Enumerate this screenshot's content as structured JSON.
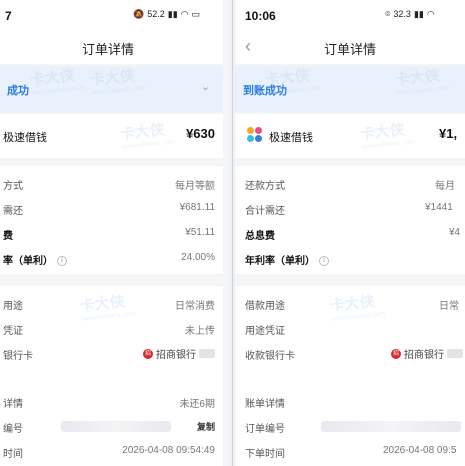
{
  "left": {
    "status_time": "7",
    "status_right": "52.2",
    "nav_title": "订单详情",
    "banner_text": "成功",
    "product_name": "极速借钱",
    "amount": "¥630",
    "rows": [
      {
        "label": "方式",
        "value": "每月等额"
      },
      {
        "label": "需还",
        "value": "¥681.11"
      },
      {
        "label": "费",
        "value": "¥51.11"
      },
      {
        "label": "率（单利）",
        "value": "24.00%"
      },
      {
        "label": "用途",
        "value": "日常消费"
      },
      {
        "label": "凭证",
        "value": "未上传"
      },
      {
        "label": "银行卡",
        "value": "招商银行"
      },
      {
        "label": "详情",
        "value": "未还6期"
      },
      {
        "label": "编号",
        "value": "复制"
      },
      {
        "label": "时间",
        "value": "2026-04-08 09:54:49"
      }
    ]
  },
  "right": {
    "status_time": "10:06",
    "status_right": "32.3",
    "nav_title": "订单详情",
    "banner_text": "到账成功",
    "product_name": "极速借钱",
    "amount": "¥1,",
    "rows": [
      {
        "label": "还款方式",
        "value": "每月"
      },
      {
        "label": "合计需还",
        "value": "¥1441"
      },
      {
        "label": "总息费",
        "value": "¥4"
      },
      {
        "label": "年利率（单利）",
        "value": ""
      },
      {
        "label": "借款用途",
        "value": "日常"
      },
      {
        "label": "用途凭证",
        "value": ""
      },
      {
        "label": "收款银行卡",
        "value": "招商银行"
      },
      {
        "label": "账单详情",
        "value": ""
      },
      {
        "label": "订单编号",
        "value": ""
      },
      {
        "label": "下单时间",
        "value": "2026-04-08 09:5"
      }
    ]
  },
  "watermark": {
    "text": "卡大侠",
    "sub": "www.kadaxia.com"
  },
  "colors": {
    "accent": "#2a7be2",
    "banner_bg": "#e8f1fc",
    "bank_red": "#d5292b"
  },
  "icons": [
    "back-chevron-icon",
    "signal-icon",
    "wifi-icon",
    "battery-icon",
    "info-icon",
    "bank-logo-icon",
    "chevron-down-icon",
    "app-logo-icon"
  ]
}
